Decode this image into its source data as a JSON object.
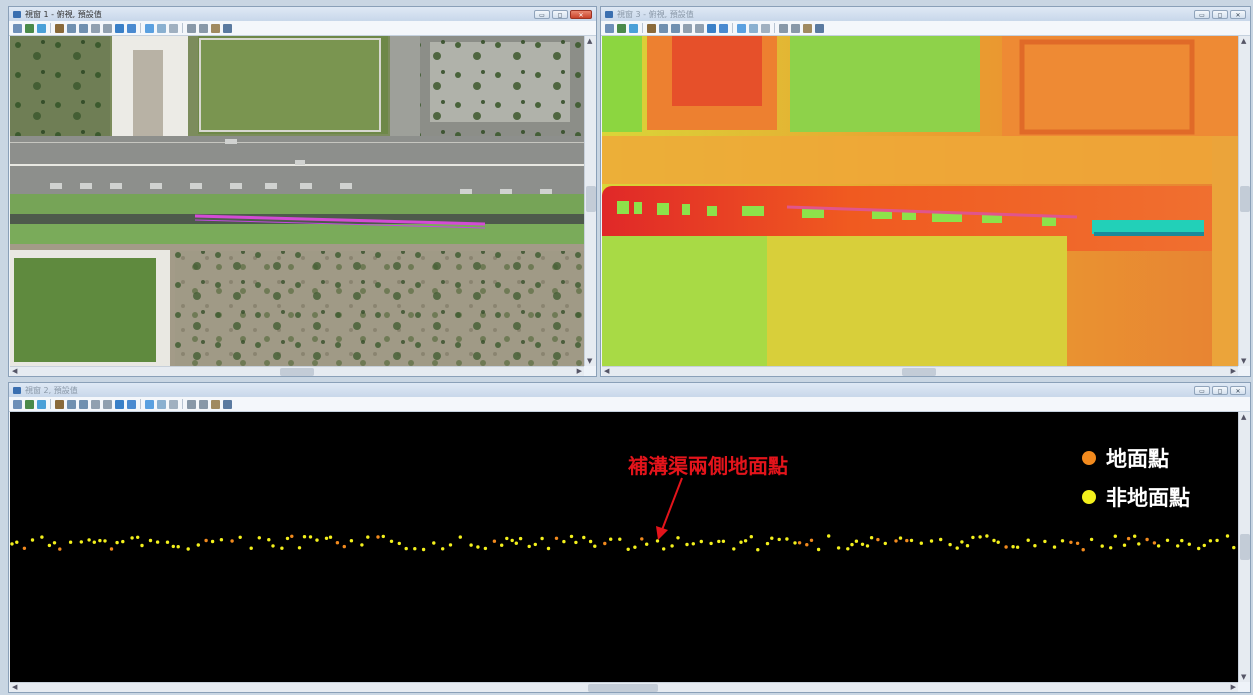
{
  "windows": {
    "view1": {
      "title": "視窗 1 - 俯視, 預設值"
    },
    "view3": {
      "title": "視窗 3 - 俯視, 預設值"
    },
    "view2": {
      "title": "視窗 2, 預設值"
    }
  },
  "annotation": {
    "label": "補溝渠兩側地面點"
  },
  "legend": [
    {
      "label": "地面點",
      "color": "#f28a1e"
    },
    {
      "label": "非地面點",
      "color": "#f3f01c"
    }
  ],
  "colors": {
    "ground_point": "#f28a1e",
    "non_ground_point": "#f3f01c",
    "annotation": "#e3141b",
    "selection_line": "#d44bd6"
  }
}
